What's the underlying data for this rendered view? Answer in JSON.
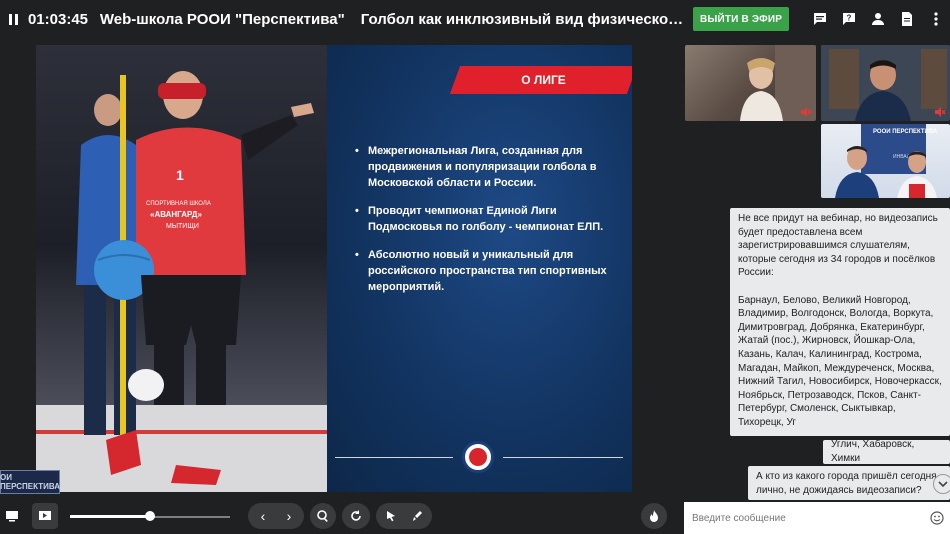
{
  "header": {
    "timer": "01:03:45",
    "school": "Web-школа РООИ \"Перспектива\"",
    "webinar_title": "Голбол как инклюзивный вид физической активно...",
    "live_button": "ВЫЙТИ В ЭФИР",
    "icons": [
      "pause-icon",
      "chat-icon",
      "question-icon",
      "user-icon",
      "file-icon",
      "more-icon"
    ]
  },
  "slide": {
    "banner": "О ЛИГЕ",
    "bullets": [
      "Межрегиональная Лига, созданная для продвижения и популяризации голбола в Московской области и России.",
      "Проводит чемпионат Единой Лиги Подмосковья по голболу - чемпионат ЕЛП.",
      "Абсолютно новый и уникальный для российского пространства тип спортивных мероприятий."
    ],
    "jersey_number": "1",
    "jersey_text_1": "СПОРТИВНАЯ ШКОЛА",
    "jersey_text_2": "«АВАНГАРД»",
    "jersey_text_3": "МЫТИЩИ"
  },
  "logo_badge": "ОИ ПЕРСПЕКТИВА",
  "toolbar": {
    "slider_value": 0.5,
    "icons": [
      "screen-icon",
      "presentation-icon",
      "prev-icon",
      "next-icon",
      "zoom-icon",
      "rotate-icon",
      "pointer-icon",
      "brush-icon",
      "fire-icon"
    ]
  },
  "videos": {
    "vid3_caption_1": "РООИ ПЕРСПЕКТИВА",
    "vid3_caption_2": "ИНВАЛИДОВ"
  },
  "chat": {
    "messages": [
      "Не все придут на вебинар, но видеозапись будет предоставлена всем зарегистрировавшимся слушателям, которые сегодня из 34 городов и посёлков России:\n\nБарнаул, Белово, Великий Новгород, Владимир, Волгодонск, Вологда, Воркута, Димитровград, Добрянка, Екатеринбург, Жатай (пос.), Жирновск, Йошкар-Ола, Казань, Калач, Калининград, Кострома, Магадан, Майкоп, Междуреченск, Москва, Нижний Тагил, Новосибирск, Новочеркасск, Ноябрьск, Петрозаводск, Псков, Санкт-Петербург, Смоленск, Сыктывкар, Тихорецк, Уг",
      "Углич, Хабаровск, Химки",
      "А кто из какого города пришёл сегодня лично, не дожидаясь видеозаписи?"
    ],
    "input_placeholder": "Введите сообщение"
  },
  "colors": {
    "accent_green": "#3aa34a",
    "banner_red": "#e0202a",
    "slide_blue": "#123461"
  }
}
